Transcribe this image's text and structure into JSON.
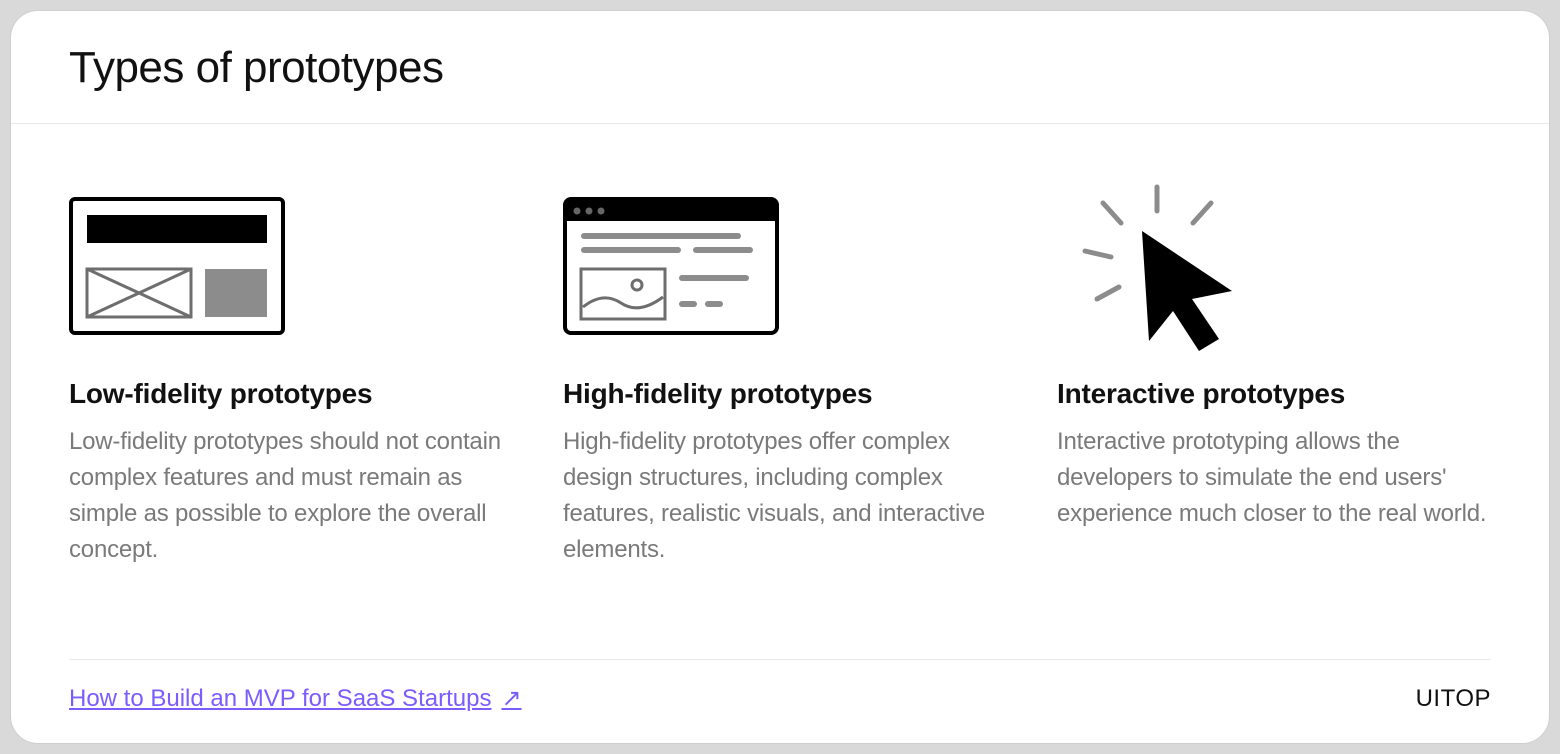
{
  "header": {
    "title": "Types of prototypes"
  },
  "columns": [
    {
      "icon": "wireframe-icon",
      "title": "Low-fidelity prototypes",
      "text": "Low-fidelity prototypes should not contain complex features and must remain as simple as possible to explore the overall concept."
    },
    {
      "icon": "browser-window-icon",
      "title": "High-fidelity prototypes",
      "text": "High-fidelity prototypes offer complex design structures, including complex features, realistic visuals, and interactive elements."
    },
    {
      "icon": "cursor-click-icon",
      "title": "Interactive prototypes",
      "text": "Interactive prototyping allows the developers to simulate the end users' experience much closer to the real world."
    }
  ],
  "footer": {
    "linkText": "How to Build an MVP for SaaS Startups",
    "arrow": "↗",
    "brand": "UITOP"
  }
}
